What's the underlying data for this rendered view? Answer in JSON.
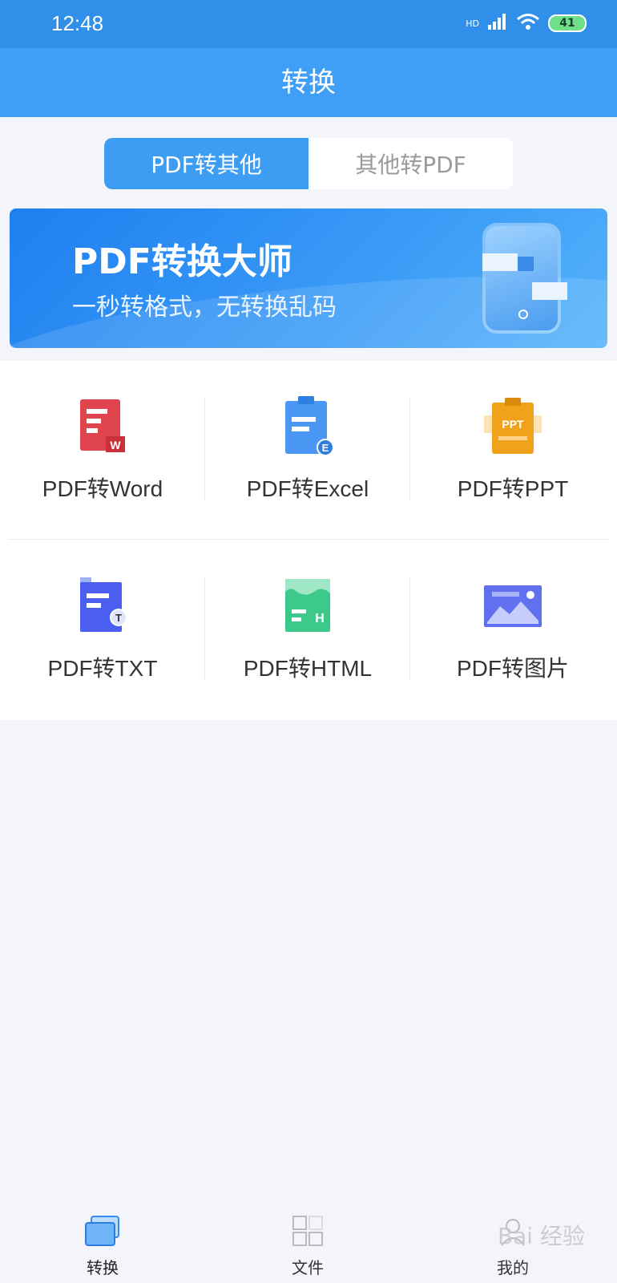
{
  "status": {
    "time": "12:48",
    "hd": "HD",
    "battery": "41"
  },
  "header": {
    "title": "转换"
  },
  "toggle": {
    "options": [
      "PDF转其他",
      "其他转PDF"
    ],
    "active_index": 0
  },
  "banner": {
    "title": "PDF转换大师",
    "subtitle": "一秒转格式，无转换乱码"
  },
  "tools": [
    {
      "label": "PDF转Word",
      "icon": "word-doc-icon",
      "color": "#e0454f"
    },
    {
      "label": "PDF转Excel",
      "icon": "excel-clipboard-icon",
      "color": "#3a8df0"
    },
    {
      "label": "PDF转PPT",
      "icon": "ppt-clipboard-icon",
      "color": "#f0a31a"
    },
    {
      "label": "PDF转TXT",
      "icon": "txt-doc-icon",
      "color": "#4a5ff0"
    },
    {
      "label": "PDF转HTML",
      "icon": "html-doc-icon",
      "color": "#3cc98a"
    },
    {
      "label": "PDF转图片",
      "icon": "image-icon",
      "color": "#6170ee"
    }
  ],
  "bottom_nav": [
    {
      "label": "转换",
      "icon": "convert-folder-icon",
      "active": true
    },
    {
      "label": "文件",
      "icon": "grid-files-icon",
      "active": false
    },
    {
      "label": "我的",
      "icon": "user-icon",
      "active": false
    }
  ],
  "watermark": {
    "text": "Bai 经验"
  }
}
